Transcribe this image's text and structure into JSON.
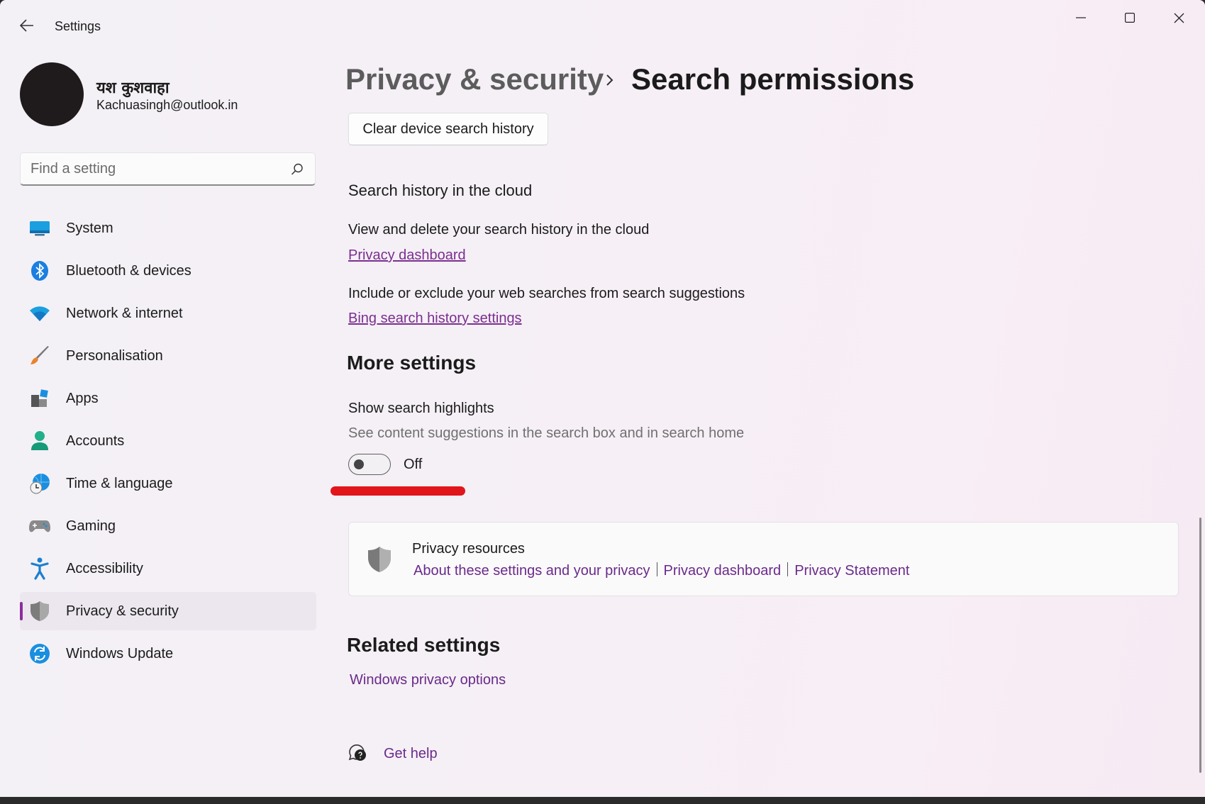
{
  "window": {
    "app_title": "Settings"
  },
  "profile": {
    "name": "यश कुशवाहा",
    "email": "Kachuasingh@outlook.in"
  },
  "search": {
    "placeholder": "Find a setting"
  },
  "nav": {
    "items": [
      {
        "label": "System",
        "icon": "system-icon"
      },
      {
        "label": "Bluetooth & devices",
        "icon": "bluetooth-icon"
      },
      {
        "label": "Network & internet",
        "icon": "wifi-icon"
      },
      {
        "label": "Personalisation",
        "icon": "brush-icon"
      },
      {
        "label": "Apps",
        "icon": "apps-icon"
      },
      {
        "label": "Accounts",
        "icon": "person-icon"
      },
      {
        "label": "Time & language",
        "icon": "globe-clock-icon"
      },
      {
        "label": "Gaming",
        "icon": "gamepad-icon"
      },
      {
        "label": "Accessibility",
        "icon": "accessibility-icon"
      },
      {
        "label": "Privacy & security",
        "icon": "shield-icon",
        "active": true
      },
      {
        "label": "Windows Update",
        "icon": "update-icon"
      }
    ]
  },
  "breadcrumb": {
    "parent": "Privacy & security",
    "current": "Search permissions"
  },
  "content": {
    "clear_button": "Clear device search history",
    "cloud_heading": "Search history in the cloud",
    "cloud_desc": "View and delete your search history in the cloud",
    "cloud_link": "Privacy dashboard",
    "bing_desc": "Include or exclude your web searches from search suggestions",
    "bing_link": "Bing search history settings",
    "more_heading": "More settings",
    "highlights_title": "Show search highlights",
    "highlights_desc": "See content suggestions in the search box and in search home",
    "highlights_state": "Off"
  },
  "privacy_resources": {
    "title": "Privacy resources",
    "links": [
      "About these settings and your privacy",
      "Privacy dashboard",
      "Privacy Statement"
    ]
  },
  "related": {
    "heading": "Related settings",
    "link": "Windows privacy options"
  },
  "help": {
    "label": "Get help"
  },
  "colors": {
    "accent": "#8a2f9c",
    "link": "#6a2a8a",
    "annotation_red": "#e0161a"
  }
}
